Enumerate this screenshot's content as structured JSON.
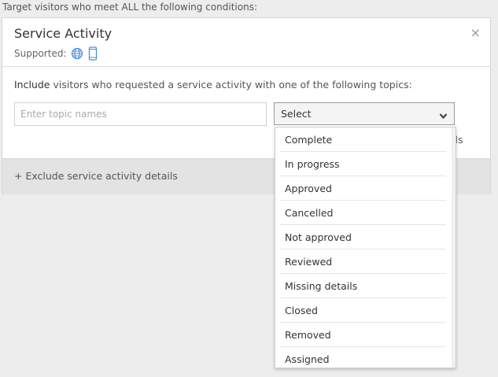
{
  "header_label": "Target visitors who meet ALL the following conditions:",
  "card": {
    "title": "Service Activity",
    "supported_label": "Supported:",
    "supported_icons": [
      "globe-icon",
      "mobile-icon"
    ],
    "close_glyph": "×",
    "include_keyword": "Include",
    "include_text": " visitors who requested a service activity with one of the following topics:",
    "topic_input": {
      "value": "",
      "placeholder": "Enter topic names"
    },
    "select": {
      "label": "Select",
      "icon": "chevron-down-icon"
    },
    "hidden_fragment": "ils",
    "exclude_label": "+ Exclude service activity details"
  },
  "dropdown": {
    "options": [
      "Complete",
      "In progress",
      "Approved",
      "Cancelled",
      "Not approved",
      "Reviewed",
      "Missing details",
      "Closed",
      "Removed",
      "Assigned"
    ]
  },
  "colors": {
    "accent_icon": "#4a8fdd",
    "page_bg": "#ededed",
    "bar_bg": "#e3e3e3"
  }
}
